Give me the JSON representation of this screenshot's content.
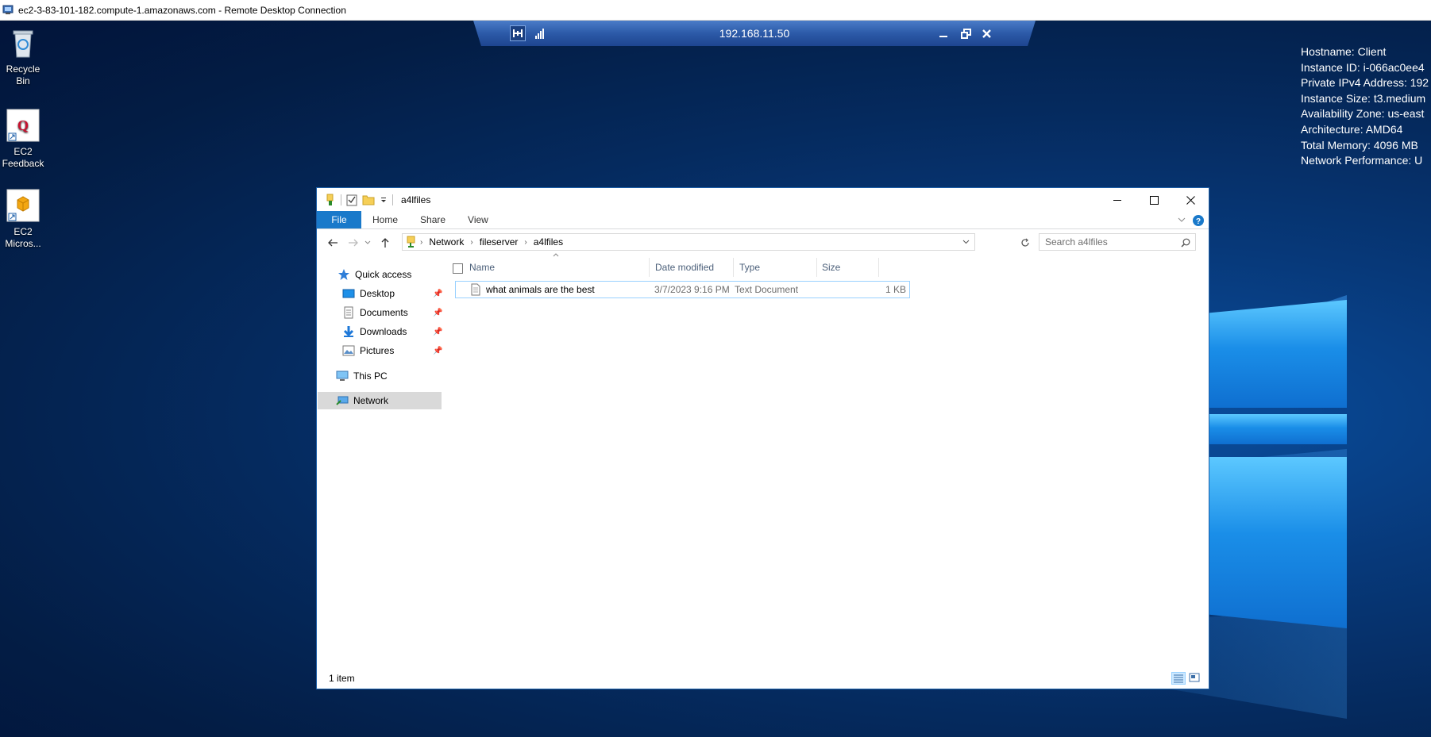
{
  "rdp": {
    "window_title": "ec2-3-83-101-182.compute-1.amazonaws.com - Remote Desktop Connection",
    "connection_ip": "192.168.11.50"
  },
  "desktop": {
    "icons": [
      {
        "label": "Recycle Bin"
      },
      {
        "label": "EC2 Feedback"
      },
      {
        "label": "EC2 Micros..."
      }
    ],
    "sysinfo": [
      "Hostname: Client",
      "Instance ID: i-066ac0ee4",
      "Private IPv4 Address: 192",
      "Instance Size: t3.medium",
      "Availability Zone: us-east",
      "Architecture: AMD64",
      "Total Memory: 4096 MB",
      "Network Performance: U"
    ]
  },
  "explorer": {
    "title": "a4lfiles",
    "ribbon_tabs": [
      "File",
      "Home",
      "Share",
      "View"
    ],
    "breadcrumb": [
      "Network",
      "fileserver",
      "a4lfiles"
    ],
    "search_placeholder": "Search a4lfiles",
    "nav": {
      "quick_access": "Quick access",
      "desktop": "Desktop",
      "documents": "Documents",
      "downloads": "Downloads",
      "pictures": "Pictures",
      "this_pc": "This PC",
      "network": "Network"
    },
    "columns": [
      "Name",
      "Date modified",
      "Type",
      "Size"
    ],
    "files": [
      {
        "name": "what animals are the best",
        "date": "3/7/2023 9:16 PM",
        "type": "Text Document",
        "size": "1 KB"
      }
    ],
    "status": "1 item"
  },
  "colors": {
    "accent": "#1979ca",
    "selection_border": "#99d1ff",
    "nav_selected": "#d9d9d9"
  }
}
